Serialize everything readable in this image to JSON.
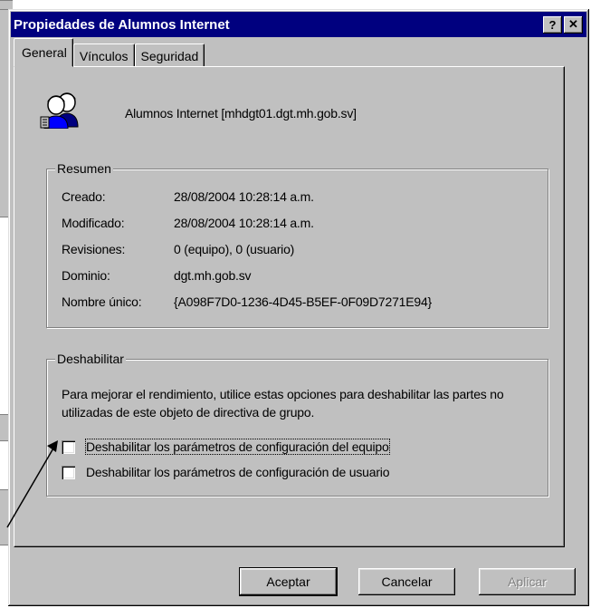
{
  "window": {
    "title": "Propiedades de Alumnos Internet",
    "help_label": "?",
    "close_label": "✕"
  },
  "tabs": [
    {
      "label": "General",
      "active": true
    },
    {
      "label": "Vínculos",
      "active": false
    },
    {
      "label": "Seguridad",
      "active": false
    }
  ],
  "gpo": {
    "icon": "users-group-icon",
    "name": "Alumnos Internet  [mhdgt01.dgt.mh.gob.sv]"
  },
  "resumen": {
    "legend": "Resumen",
    "rows": [
      {
        "label": "Creado:",
        "value": "28/08/2004 10:28:14 a.m."
      },
      {
        "label": "Modificado:",
        "value": "28/08/2004 10:28:14 a.m."
      },
      {
        "label": "Revisiones:",
        "value": "0 (equipo), 0 (usuario)"
      },
      {
        "label": "Dominio:",
        "value": "dgt.mh.gob.sv"
      },
      {
        "label": "Nombre único:",
        "value": "{A098F7D0-1236-4D45-B5EF-0F09D7271E94}"
      }
    ]
  },
  "deshabilitar": {
    "legend": "Deshabilitar",
    "description": "Para mejorar el rendimiento, utilice estas opciones para deshabilitar las partes no utilizadas de este objeto de directiva de grupo.",
    "options": [
      {
        "label": "Deshabilitar los parámetros de configuración del equipo",
        "checked": false
      },
      {
        "label": "Deshabilitar los parámetros de configuración de usuario",
        "checked": false
      }
    ]
  },
  "buttons": {
    "ok": "Aceptar",
    "cancel": "Cancelar",
    "apply": "Aplicar"
  },
  "colors": {
    "titlebar": "#00007f",
    "face": "#c0c0c0"
  }
}
